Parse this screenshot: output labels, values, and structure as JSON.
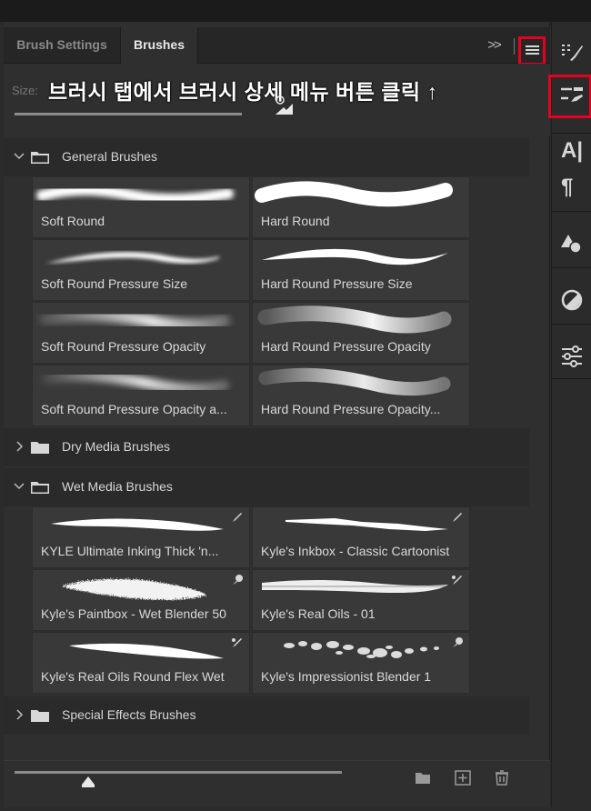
{
  "tabs": {
    "brush_settings": "Brush Settings",
    "brushes": "Brushes",
    "collapse": ">>"
  },
  "size_label": "Size:",
  "annotation": "브러시 탭에서 브러시 상세 메뉴 버튼 클릭 ↑",
  "groups": {
    "general": "General Brushes",
    "dry": "Dry Media Brushes",
    "wet": "Wet Media Brushes",
    "special": "Special Effects Brushes"
  },
  "general_brushes": [
    "Soft Round",
    "Hard Round",
    "Soft Round Pressure Size",
    "Hard Round Pressure Size",
    "Soft Round Pressure Opacity",
    "Hard Round Pressure Opacity",
    "Soft Round Pressure Opacity a...",
    "Hard Round Pressure Opacity..."
  ],
  "wet_brushes": [
    "KYLE Ultimate Inking Thick 'n...",
    "Kyle's Inkbox - Classic Cartoonist",
    "Kyle's Paintbox - Wet Blender 50",
    "Kyle's Real Oils - 01",
    "Kyle's Real Oils Round Flex Wet",
    "Kyle's Impressionist Blender 1"
  ],
  "rightbar": {
    "type_icon_text": "A|",
    "paragraph_icon_text": "¶"
  },
  "colors": {
    "highlight": "#e6001f",
    "panel_bg": "#2f2f2f",
    "tile_bg": "#393939"
  }
}
